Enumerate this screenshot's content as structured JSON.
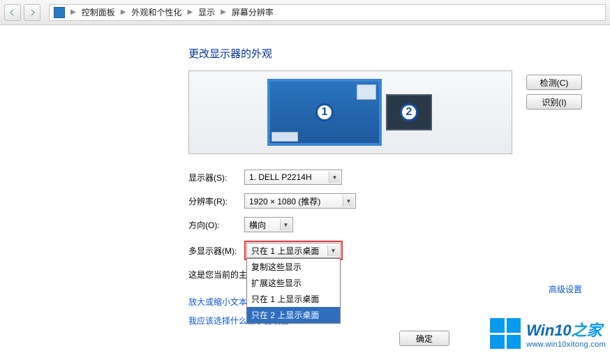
{
  "breadcrumb": {
    "items": [
      "控制面板",
      "外观和个性化",
      "显示",
      "屏幕分辨率"
    ]
  },
  "page_title": "更改显示器的外观",
  "monitors": {
    "primary": "1",
    "secondary": "2"
  },
  "buttons": {
    "detect": "检测(C)",
    "identify": "识别(I)",
    "ok": "确定"
  },
  "form": {
    "display_label": "显示器(S):",
    "display_value": "1. DELL P2214H",
    "resolution_label": "分辨率(R):",
    "resolution_value": "1920 × 1080 (推荐)",
    "orientation_label": "方向(O):",
    "orientation_value": "横向",
    "multi_label": "多显示器(M):",
    "multi_value": "只在 1 上显示桌面",
    "multi_options": [
      "复制这些显示",
      "扩展这些显示",
      "只在 1 上显示桌面",
      "只在 2 上显示桌面"
    ],
    "multi_selected_index": 3
  },
  "static_text": {
    "current_main_prefix": "这是您当前的主",
    "zoom_link_prefix": "放大或缩小文本",
    "help_link": "我应该选择什么显示器设置？",
    "advanced": "高级设置"
  },
  "watermark": {
    "brand_en": "Win10",
    "brand_zh": "之家",
    "url": "www.win10xitong.com"
  }
}
